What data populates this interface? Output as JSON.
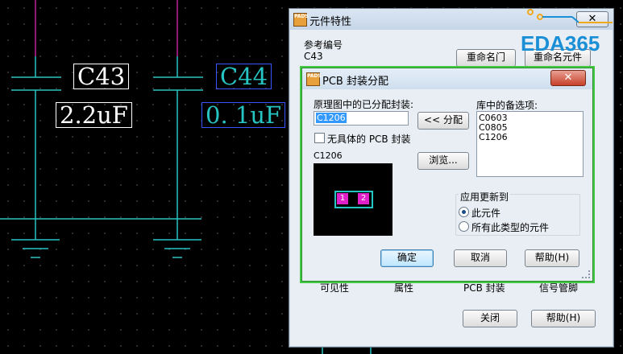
{
  "schematic": {
    "c43": {
      "ref": "C43",
      "value": "2.2uF"
    },
    "c44": {
      "ref": "C44",
      "value": "0. 1uF"
    }
  },
  "watermark": {
    "text": "EDA365"
  },
  "properties_dialog": {
    "title": "元件特性",
    "ref_label": "参考编号",
    "ref_value": "C43",
    "rename_gate_button": "重命名门",
    "rename_part_button": "重命名元件",
    "lower_tabs": [
      "可见性",
      "属性",
      "PCB 封装",
      "信号管脚"
    ],
    "close_button": "关闭",
    "help_button": "帮助(H)"
  },
  "pcb_dialog": {
    "title": "PCB 封装分配",
    "assigned_label": "原理图中的已分配封装:",
    "assigned_value": "C1206",
    "assign_button": "<< 分配",
    "no_decal_checkbox": "无具体的 PCB 封装",
    "no_decal_checked": false,
    "preview_label": "C1206",
    "pad_numbers": [
      "1",
      "2"
    ],
    "library_label": "库中的备选项:",
    "library_items": [
      "C0603",
      "C0805",
      "C1206"
    ],
    "browse_button": "浏览...",
    "apply_group_label": "应用更新到",
    "apply_options": [
      {
        "label": "此元件",
        "selected": true
      },
      {
        "label": "所有此类型的元件",
        "selected": false
      }
    ],
    "ok_button": "确定",
    "cancel_button": "取消",
    "help_button": "帮助(H)"
  },
  "colors": {
    "wire_cyan": "#27c4c4",
    "wire_magenta": "#c0209e",
    "pad_magenta": "#e020c8",
    "selection_blue": "#3399ff"
  }
}
